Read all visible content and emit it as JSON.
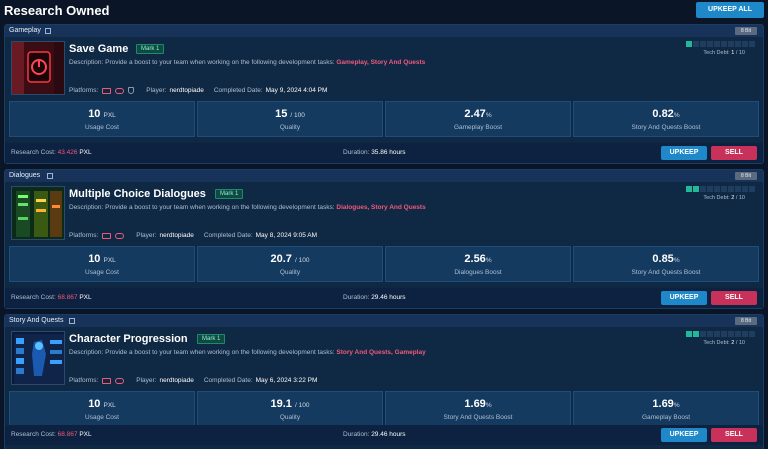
{
  "header": {
    "title": "Research Owned",
    "upkeep_all_label": "UPKEEP ALL"
  },
  "labels": {
    "description_prefix": "Description: Provide a boost to your team when working on the following development tasks: ",
    "platforms": "Platforms:",
    "player": "Player:",
    "completed": "Completed Date:",
    "tech_debt": "Tech Debt:",
    "research_cost": "Research Cost:",
    "duration": "Duration:",
    "upkeep": "UPKEEP",
    "sell": "SELL",
    "bit_badge": "8 Bit",
    "usage_cost": "Usage Cost",
    "quality": "Quality",
    "pxl_unit": "PXL",
    "quality_suffix": "/ 100",
    "tech_suffix": "/ 10",
    "pct": "%"
  },
  "colors": {
    "accent": "#1e88c8",
    "danger": "#c8325a",
    "highlight": "#f05a7a",
    "tech_on": "#23b89a"
  },
  "cards": [
    {
      "category": "Gameplay",
      "title": "Save Game",
      "mark": "Mark 1",
      "tasks": "Gameplay, Story And Quests",
      "player": "nerdtopiade",
      "completed": "May 9, 2024 4:04 PM",
      "tech_debt": "1",
      "tech_debt_fill": 0.1,
      "usage_cost": "10",
      "quality": "15",
      "boost1_value": "2.47",
      "boost1_label": "Gameplay Boost",
      "boost2_value": "0.82",
      "boost2_label": "Story And Quests Boost",
      "research_cost": "43.426",
      "duration": "35.86 hours",
      "platform_icons": [
        "gamepad-icon",
        "controller-icon",
        "joystick-icon"
      ]
    },
    {
      "category": "Dialogues",
      "title": "Multiple Choice Dialogues",
      "mark": "Mark 1",
      "tasks": "Dialogues, Story And Quests",
      "player": "nerdtopiade",
      "completed": "May 8, 2024 9:05 AM",
      "tech_debt": "2",
      "tech_debt_fill": 0.2,
      "usage_cost": "10",
      "quality": "20.7",
      "boost1_value": "2.56",
      "boost1_label": "Dialogues Boost",
      "boost2_value": "0.85",
      "boost2_label": "Story And Quests Boost",
      "research_cost": "68.867",
      "duration": "29.46 hours",
      "platform_icons": [
        "gamepad-icon",
        "controller-icon"
      ]
    },
    {
      "category": "Story And Quests",
      "title": "Character Progression",
      "mark": "Mark 1",
      "tasks": "Story And Quests, Gameplay",
      "player": "nerdtopiade",
      "completed": "May 6, 2024 3:22 PM",
      "tech_debt": "2",
      "tech_debt_fill": 0.2,
      "usage_cost": "10",
      "quality": "19.1",
      "boost1_value": "1.69",
      "boost1_label": "Story And Quests Boost",
      "boost2_value": "1.69",
      "boost2_label": "Gameplay Boost",
      "research_cost": "68.867",
      "duration": "29.46 hours",
      "platform_icons": [
        "gamepad-icon",
        "controller-icon"
      ]
    }
  ]
}
